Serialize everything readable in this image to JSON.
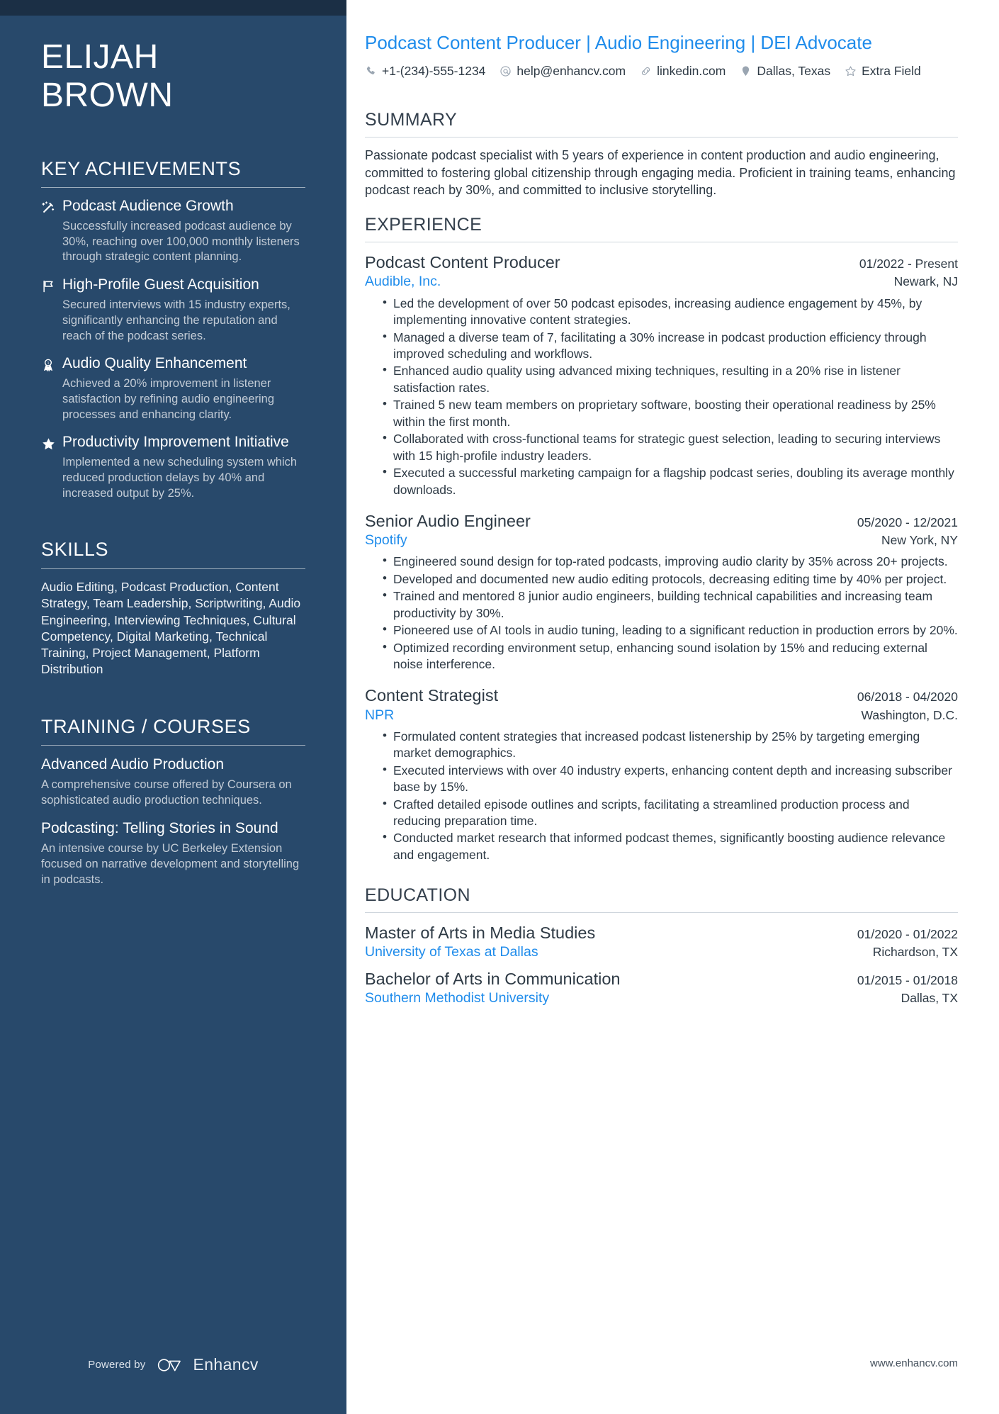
{
  "sidebar": {
    "name_first": "ELIJAH",
    "name_last": "BROWN",
    "achievements_heading": "KEY ACHIEVEMENTS",
    "achievements": [
      {
        "icon": "magic-wand-icon",
        "title": "Podcast Audience Growth",
        "desc": "Successfully increased podcast audience by 30%, reaching over 100,000 monthly listeners through strategic content planning."
      },
      {
        "icon": "flag-icon",
        "title": "High-Profile Guest Acquisition",
        "desc": "Secured interviews with 15 industry experts, significantly enhancing the reputation and reach of the podcast series."
      },
      {
        "icon": "award-ribbon-icon",
        "title": "Audio Quality Enhancement",
        "desc": "Achieved a 20% improvement in listener satisfaction by refining audio engineering processes and enhancing clarity."
      },
      {
        "icon": "star-icon",
        "title": "Productivity Improvement Initiative",
        "desc": "Implemented a new scheduling system which reduced production delays by 40% and increased output by 25%."
      }
    ],
    "skills_heading": "SKILLS",
    "skills_text": "Audio Editing, Podcast Production, Content Strategy, Team Leadership, Scriptwriting, Audio Engineering, Interviewing Techniques, Cultural Competency, Digital Marketing, Technical Training, Project Management, Platform Distribution",
    "training_heading": "TRAINING / COURSES",
    "courses": [
      {
        "title": "Advanced Audio Production",
        "desc": "A comprehensive course offered by Coursera on sophisticated audio production techniques."
      },
      {
        "title": "Podcasting: Telling Stories in Sound",
        "desc": "An intensive course by UC Berkeley Extension focused on narrative development and storytelling in podcasts."
      }
    ],
    "powered_by": "Powered by",
    "brand": "Enhancv"
  },
  "header": {
    "headline": "Podcast Content Producer | Audio Engineering | DEI Advocate",
    "contacts": [
      {
        "icon": "phone-icon",
        "value": "+1-(234)-555-1234"
      },
      {
        "icon": "email-icon",
        "value": "help@enhancv.com"
      },
      {
        "icon": "link-icon",
        "value": "linkedin.com"
      },
      {
        "icon": "location-pin-icon",
        "value": "Dallas, Texas"
      },
      {
        "icon": "star-outline-icon",
        "value": "Extra Field"
      }
    ]
  },
  "summary": {
    "heading": "SUMMARY",
    "text": "Passionate podcast specialist with 5 years of experience in content production and audio engineering, committed to fostering global citizenship through engaging media. Proficient in training teams, enhancing podcast reach by 30%, and committed to inclusive storytelling."
  },
  "experience": {
    "heading": "EXPERIENCE",
    "entries": [
      {
        "position": "Podcast Content Producer",
        "date": "01/2022 - Present",
        "company": "Audible, Inc.",
        "location": "Newark, NJ",
        "bullets": [
          "Led the development of over 50 podcast episodes, increasing audience engagement by 45%, by implementing innovative content strategies.",
          "Managed a diverse team of 7, facilitating a 30% increase in podcast production efficiency through improved scheduling and workflows.",
          "Enhanced audio quality using advanced mixing techniques, resulting in a 20% rise in listener satisfaction rates.",
          "Trained 5 new team members on proprietary software, boosting their operational readiness by 25% within the first month.",
          "Collaborated with cross-functional teams for strategic guest selection, leading to securing interviews with 15 high-profile industry leaders.",
          "Executed a successful marketing campaign for a flagship podcast series, doubling its average monthly downloads."
        ]
      },
      {
        "position": "Senior Audio Engineer",
        "date": "05/2020 - 12/2021",
        "company": "Spotify",
        "location": "New York, NY",
        "bullets": [
          "Engineered sound design for top-rated podcasts, improving audio clarity by 35% across 20+ projects.",
          "Developed and documented new audio editing protocols, decreasing editing time by 40% per project.",
          "Trained and mentored 8 junior audio engineers, building technical capabilities and increasing team productivity by 30%.",
          "Pioneered use of AI tools in audio tuning, leading to a significant reduction in production errors by 20%.",
          "Optimized recording environment setup, enhancing sound isolation by 15% and reducing external noise interference."
        ]
      },
      {
        "position": "Content Strategist",
        "date": "06/2018 - 04/2020",
        "company": "NPR",
        "location": "Washington, D.C.",
        "bullets": [
          "Formulated content strategies that increased podcast listenership by 25% by targeting emerging market demographics.",
          "Executed interviews with over 40 industry experts, enhancing content depth and increasing subscriber base by 15%.",
          "Crafted detailed episode outlines and scripts, facilitating a streamlined production process and reducing preparation time.",
          "Conducted market research that informed podcast themes, significantly boosting audience relevance and engagement."
        ]
      }
    ]
  },
  "education": {
    "heading": "EDUCATION",
    "entries": [
      {
        "degree": "Master of Arts in Media Studies",
        "date": "01/2020 - 01/2022",
        "school": "University of Texas at Dallas",
        "location": "Richardson, TX"
      },
      {
        "degree": "Bachelor of Arts in Communication",
        "date": "01/2015 - 01/2018",
        "school": "Southern Methodist University",
        "location": "Dallas, TX"
      }
    ]
  },
  "footer": {
    "website": "www.enhancv.com"
  },
  "colors": {
    "sidebar_bg": "#28496b",
    "sidebar_topbar": "#1b2f45",
    "accent_blue": "#1f8ceb",
    "body_text": "#2e3a45"
  }
}
